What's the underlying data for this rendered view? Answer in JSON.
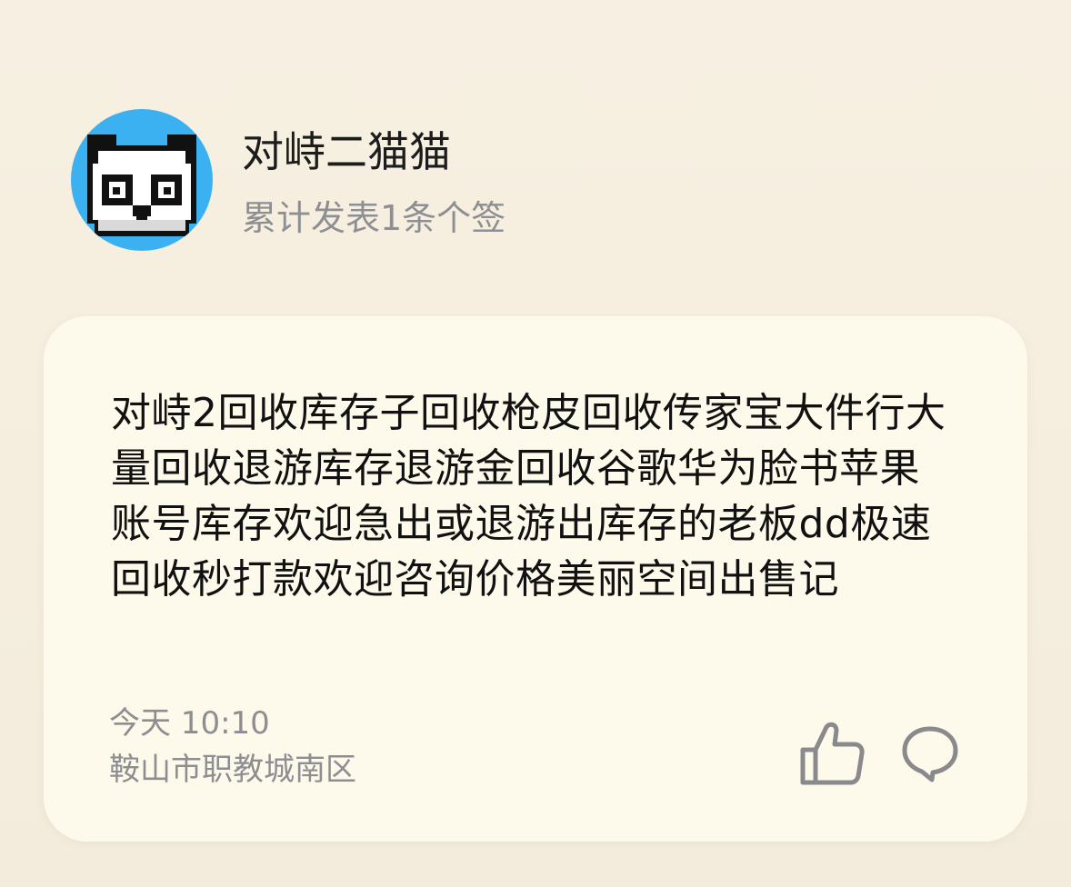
{
  "profile": {
    "username": "对峙二猫猫",
    "post_count": "累计发表1条个签",
    "avatar_icon": "panda-icon",
    "avatar_bg_color": "#3bb1f1"
  },
  "post": {
    "text": "对峙2回收库存子回收枪皮回收传家宝大件行大量回收退游库存退游金回收谷歌华为脸书苹果账号库存欢迎急出或退游出库存的老板dd极速回收秒打款欢迎咨询价格美丽空间出售记",
    "timestamp": "今天 10:10",
    "location": "鞍山市职教城南区",
    "actions": {
      "like_icon": "thumbs-up-icon",
      "comment_icon": "comment-icon"
    }
  },
  "colors": {
    "background": "#f6efe0",
    "card": "#fefaeb",
    "text_primary": "#111111",
    "text_secondary": "#8e8e92",
    "icon": "#8a8a8c"
  }
}
